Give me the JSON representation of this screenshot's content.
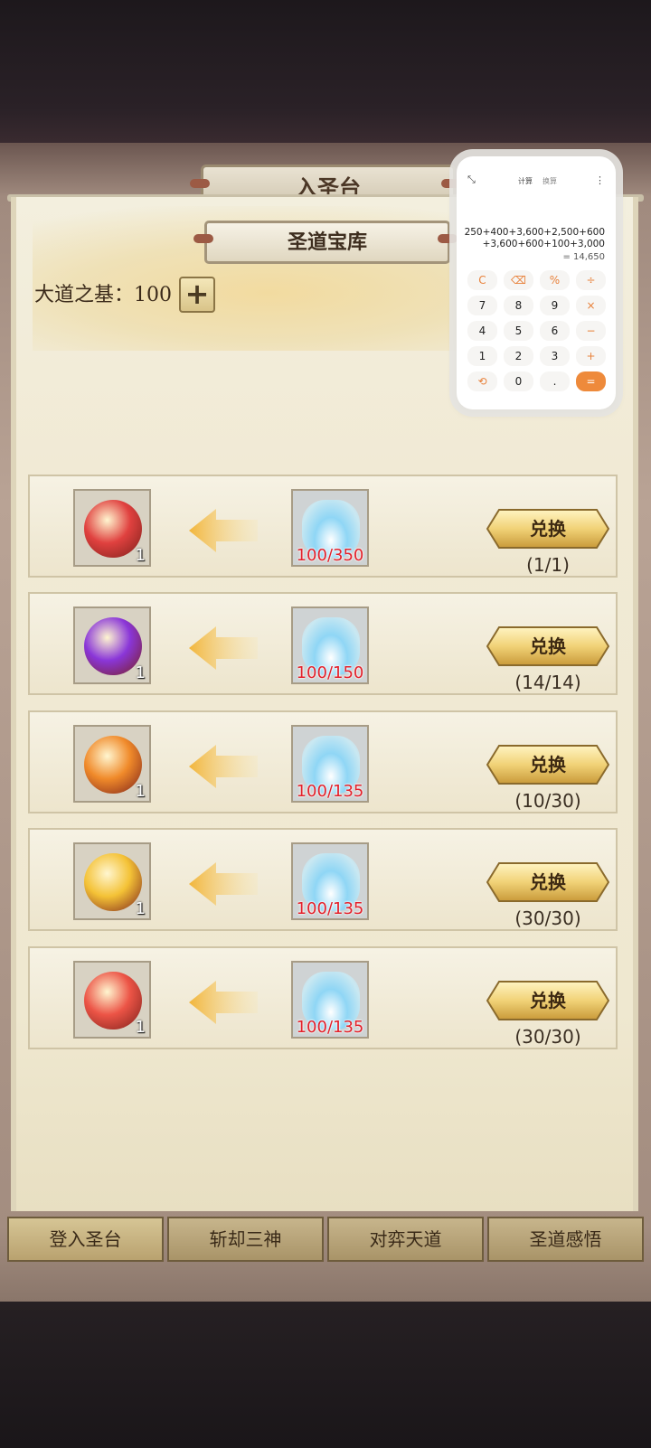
{
  "outer_title": "入圣台",
  "panel_title": "圣道宝库",
  "foundation": {
    "label": "大道之基：100",
    "plus_icon": "plus-icon"
  },
  "exchange_rows": [
    {
      "item_icon": "red-flame-orb-icon",
      "item_qty": "1",
      "cost_icon": "blue-crystal-spring-icon",
      "cost": "100/350",
      "button": "兑换",
      "limit": "(1/1)",
      "orb_color": "#e0413f"
    },
    {
      "item_icon": "purple-crystal-ball-icon",
      "item_qty": "1",
      "cost_icon": "blue-crystal-spring-icon",
      "cost": "100/150",
      "button": "兑换",
      "limit": "(14/14)",
      "orb_color": "#8a36d8"
    },
    {
      "item_icon": "orange-sword-orb-icon",
      "item_qty": "1",
      "cost_icon": "blue-crystal-spring-icon",
      "cost": "100/135",
      "button": "兑换",
      "limit": "(10/30)",
      "orb_color": "#f08a2a"
    },
    {
      "item_icon": "golden-armor-orb-icon",
      "item_qty": "1",
      "cost_icon": "blue-crystal-spring-icon",
      "cost": "100/135",
      "button": "兑换",
      "limit": "(30/30)",
      "orb_color": "#f4c236"
    },
    {
      "item_icon": "red-candle-orb-icon",
      "item_qty": "1",
      "cost_icon": "blue-crystal-spring-icon",
      "cost": "100/135",
      "button": "兑换",
      "limit": "(30/30)",
      "orb_color": "#ec5446"
    }
  ],
  "bottom_tabs": [
    "登入圣台",
    "斩却三神",
    "对弈天道",
    "圣道感悟"
  ],
  "calculator": {
    "tab_calc": "计算",
    "tab_convert": "换算",
    "expression_line1": "250+400+3,600+2,500+600",
    "expression_line2": "+3,600+600+100+3,000",
    "result": "= 14,650",
    "keys": [
      "C",
      "⌫",
      "%",
      "÷",
      "7",
      "8",
      "9",
      "×",
      "4",
      "5",
      "6",
      "−",
      "1",
      "2",
      "3",
      "+",
      "⟲",
      "0",
      ".",
      "="
    ]
  }
}
